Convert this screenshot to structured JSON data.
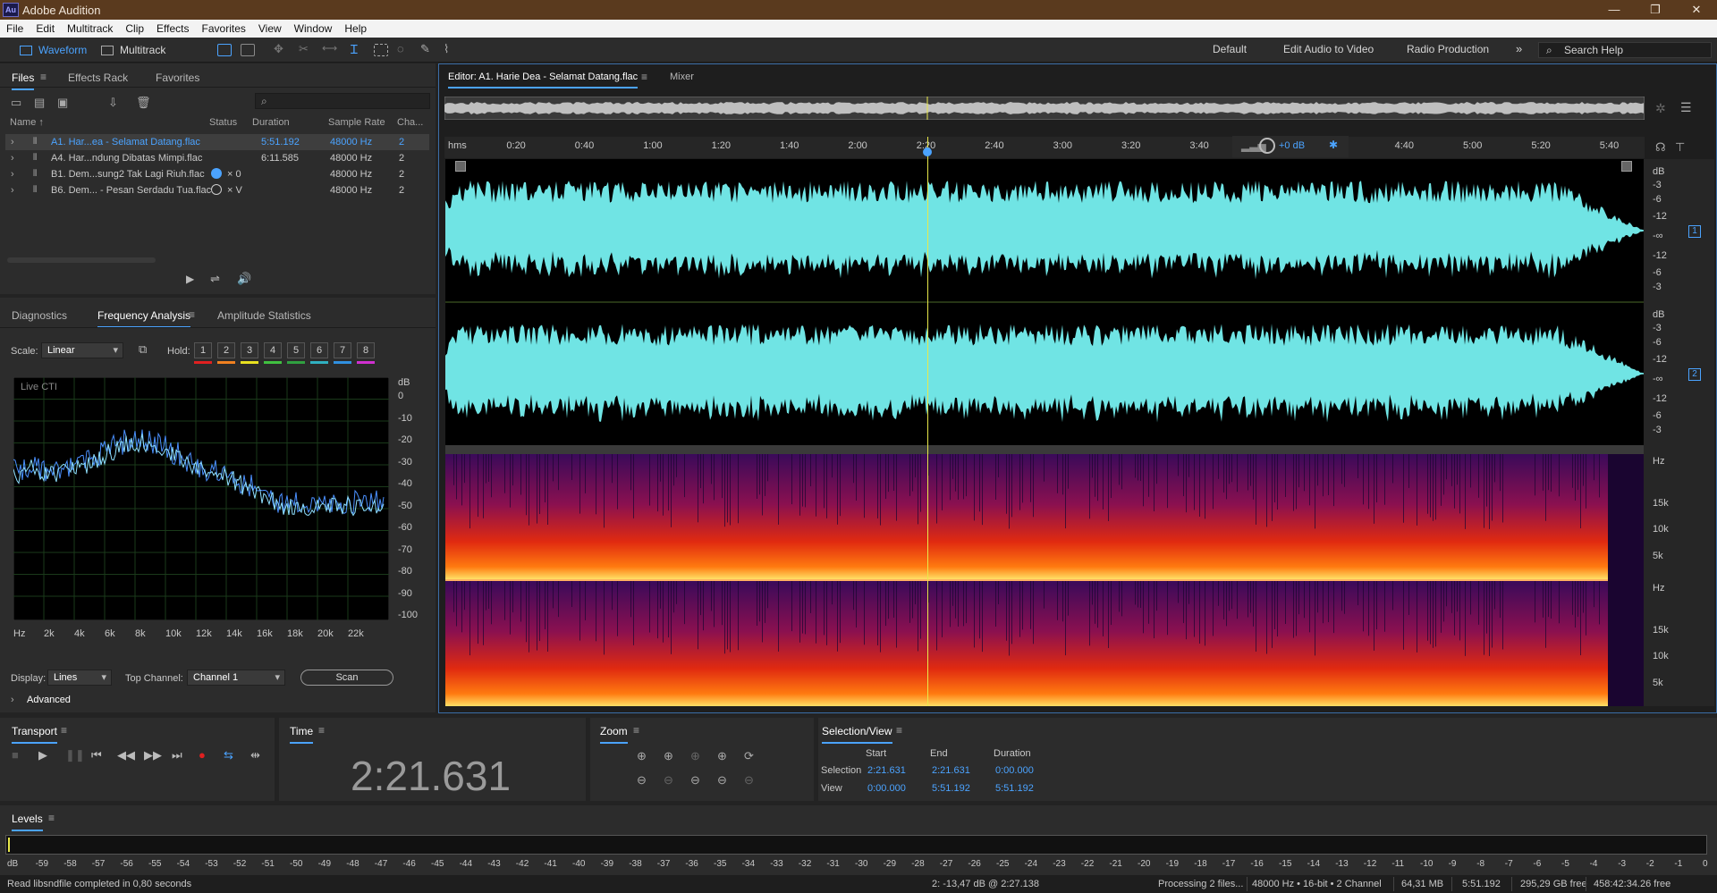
{
  "app": {
    "title": "Adobe Audition",
    "logo": "Au"
  },
  "menu": [
    "File",
    "Edit",
    "Multitrack",
    "Clip",
    "Effects",
    "Favorites",
    "View",
    "Window",
    "Help"
  ],
  "toolbar": {
    "waveform": "Waveform",
    "multitrack": "Multitrack"
  },
  "workspaces": [
    "Default",
    "Edit Audio to Video",
    "Radio Production"
  ],
  "search_help": "Search Help",
  "files_panel": {
    "tabs": [
      "Files",
      "Effects Rack",
      "Favorites"
    ],
    "columns": [
      "Name ↑",
      "Status",
      "Duration",
      "Sample Rate",
      "Cha..."
    ],
    "rows": [
      {
        "name": "A1. Har...ea - Selamat Datang.flac",
        "status": "",
        "duration": "5:51.192",
        "rate": "48000 Hz",
        "channels": "2"
      },
      {
        "name": "A4. Har...ndung Dibatas Mimpi.flac",
        "status": "",
        "duration": "6:11.585",
        "rate": "48000 Hz",
        "channels": "2"
      },
      {
        "name": "B1. Dem...sung2 Tak Lagi Riuh.flac",
        "status": "× 0",
        "duration": "",
        "rate": "48000 Hz",
        "channels": "2"
      },
      {
        "name": "B6. Dem... - Pesan Serdadu Tua.flac",
        "status": "× V",
        "duration": "",
        "rate": "48000 Hz",
        "channels": "2"
      }
    ]
  },
  "analysis": {
    "tabs": [
      "Diagnostics",
      "Frequency Analysis",
      "Amplitude Statistics"
    ],
    "scale_label": "Scale:",
    "scale_value": "Linear",
    "hold_label": "Hold:",
    "hold_buttons": [
      "1",
      "2",
      "3",
      "4",
      "5",
      "6",
      "7",
      "8"
    ],
    "hold_colors": [
      "#e02020",
      "#f08020",
      "#e8e020",
      "#40c040",
      "#30a040",
      "#30b0c0",
      "#3090e0",
      "#d030d0"
    ],
    "graph_label": "Live CTI",
    "db_unit": "dB",
    "db_ticks": [
      "0",
      "-10",
      "-20",
      "-30",
      "-40",
      "-50",
      "-60",
      "-70",
      "-80",
      "-90",
      "-100"
    ],
    "hz_ticks": [
      "Hz",
      "2k",
      "4k",
      "6k",
      "8k",
      "10k",
      "12k",
      "14k",
      "16k",
      "18k",
      "20k",
      "22k"
    ],
    "display_label": "Display:",
    "display_value": "Lines",
    "top_channel_label": "Top Channel:",
    "top_channel_value": "Channel 1",
    "scan": "Scan",
    "advanced": "Advanced"
  },
  "editor": {
    "tab": "Editor: A1. Harie Dea - Selamat Datang.flac",
    "mixer": "Mixer",
    "timeline_unit": "hms",
    "timeline_ticks": [
      "0:20",
      "0:40",
      "1:00",
      "1:20",
      "1:40",
      "2:00",
      "2:20",
      "2:40",
      "3:00",
      "3:20",
      "3:40",
      "4:20",
      "4:40",
      "5:00",
      "5:20",
      "5:40"
    ],
    "volume": "+0 dB",
    "db_ticks_ch": [
      "dB",
      "-3",
      "-6",
      "-12",
      "-∞",
      "-12",
      "-6",
      "-3"
    ],
    "channels": [
      "1",
      "2"
    ],
    "hz_ticks": [
      "Hz",
      "15k",
      "10k",
      "5k"
    ],
    "waveform_color": "#70e4e4",
    "playhead_color": "#e8e84a"
  },
  "transport": {
    "title": "Transport"
  },
  "time": {
    "title": "Time",
    "value": "2:21.631"
  },
  "zoom": {
    "title": "Zoom"
  },
  "selection_view": {
    "title": "Selection/View",
    "headers": [
      "Start",
      "End",
      "Duration"
    ],
    "selection_label": "Selection",
    "selection": [
      "2:21.631",
      "2:21.631",
      "0:00.000"
    ],
    "view_label": "View",
    "view": [
      "0:00.000",
      "5:51.192",
      "5:51.192"
    ]
  },
  "levels": {
    "title": "Levels",
    "ticks": [
      "dB",
      "-59",
      "-58",
      "-57",
      "-56",
      "-55",
      "-54",
      "-53",
      "-52",
      "-51",
      "-50",
      "-49",
      "-48",
      "-47",
      "-46",
      "-45",
      "-44",
      "-43",
      "-42",
      "-41",
      "-40",
      "-39",
      "-38",
      "-37",
      "-36",
      "-35",
      "-34",
      "-33",
      "-32",
      "-31",
      "-30",
      "-29",
      "-28",
      "-27",
      "-26",
      "-25",
      "-24",
      "-23",
      "-22",
      "-21",
      "-20",
      "-19",
      "-18",
      "-17",
      "-16",
      "-15",
      "-14",
      "-13",
      "-12",
      "-11",
      "-10",
      "-9",
      "-8",
      "-7",
      "-6",
      "-5",
      "-4",
      "-3",
      "-2",
      "-1",
      "0"
    ]
  },
  "status": {
    "left": "Read libsndfile completed in 0,80 seconds",
    "cursor": "2: -13,47 dB @ 2:27.138",
    "processing": "Processing 2 files...",
    "format": "48000 Hz • 16-bit • 2 Channel",
    "size": "64,31 MB",
    "duration": "5:51.192",
    "free": "295,29 GB free",
    "time_free": "458:42:34.26 free"
  }
}
